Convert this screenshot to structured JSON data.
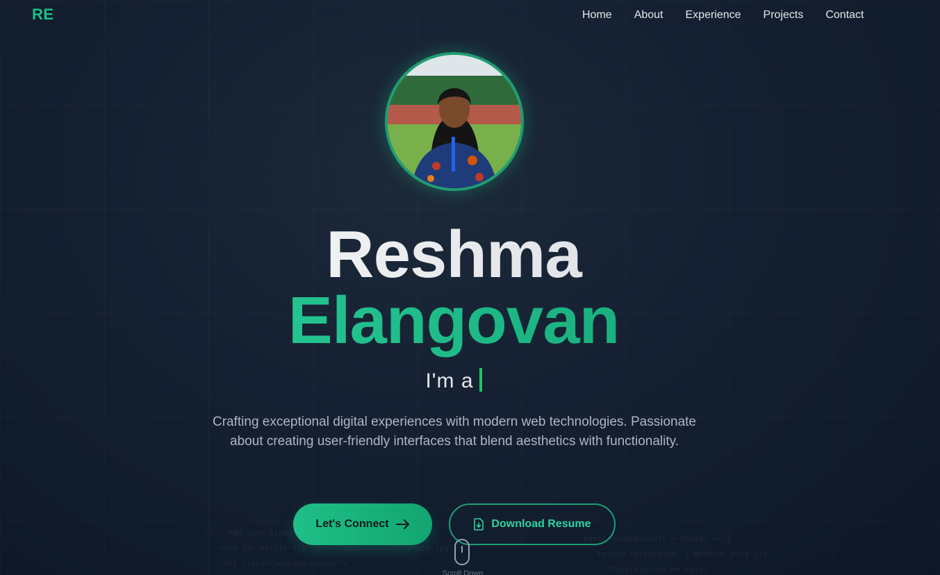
{
  "logo": "RE",
  "nav": {
    "items": [
      "Home",
      "About",
      "Experience",
      "Projects",
      "Contact"
    ]
  },
  "hero": {
    "first_name": "Reshma",
    "last_name": "Elangovan",
    "typer_prefix": "I'm a",
    "description": "Crafting exceptional digital experiences with modern web technologies. Passionate about creating user-friendly interfaces that blend aesthetics with functionality.",
    "connect_label": "Let's Connect",
    "resume_label": "Download Resume",
    "scroll_label": "Scroll Down"
  },
  "colors": {
    "accent": "#1fbf87",
    "background": "#142031"
  }
}
